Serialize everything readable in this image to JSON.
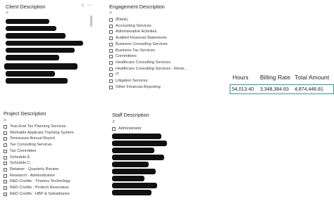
{
  "client": {
    "title": "Client Description",
    "search_icon": "search-icon",
    "pin_icon": "pin-icon",
    "more_icon": "more-icon"
  },
  "engagement": {
    "title": "Engagement Description",
    "items": [
      "(Blank)",
      "Accounting Services",
      "Administrative Activities",
      "Audited Financial Statements",
      "Business Consulting Services",
      "Business Tax Services",
      "Committees",
      "Healthcare Consulting Services",
      "Healthcare Consulting Services - Revie...",
      "IT",
      "Litigation Services",
      "Other Financial Reporting"
    ]
  },
  "project": {
    "title": "Project Description",
    "items": [
      "Year-End Tax Planning Services",
      "Workable Applicant Tracking System",
      "Tennessee Annual Report",
      "Tax Consulting Services",
      "Tax Committee",
      "Schedule E",
      "Schedule C",
      "Retainer - Quarterly Review",
      "Research - Administrative",
      "R&D Credits - Thames Technology",
      "R&D Credits - Protech Associates",
      "R&D Credits - HBP & Subsidiaries"
    ]
  },
  "staff": {
    "title": "Staff Description",
    "first_item": "Administrator"
  },
  "kpi": {
    "headers": [
      "Hours",
      "Billing Rate",
      "Total Amount"
    ],
    "values": [
      "54,013.40",
      "3,348,384.63",
      "4,874,446.81"
    ],
    "border_color": "#2a9d8f"
  }
}
